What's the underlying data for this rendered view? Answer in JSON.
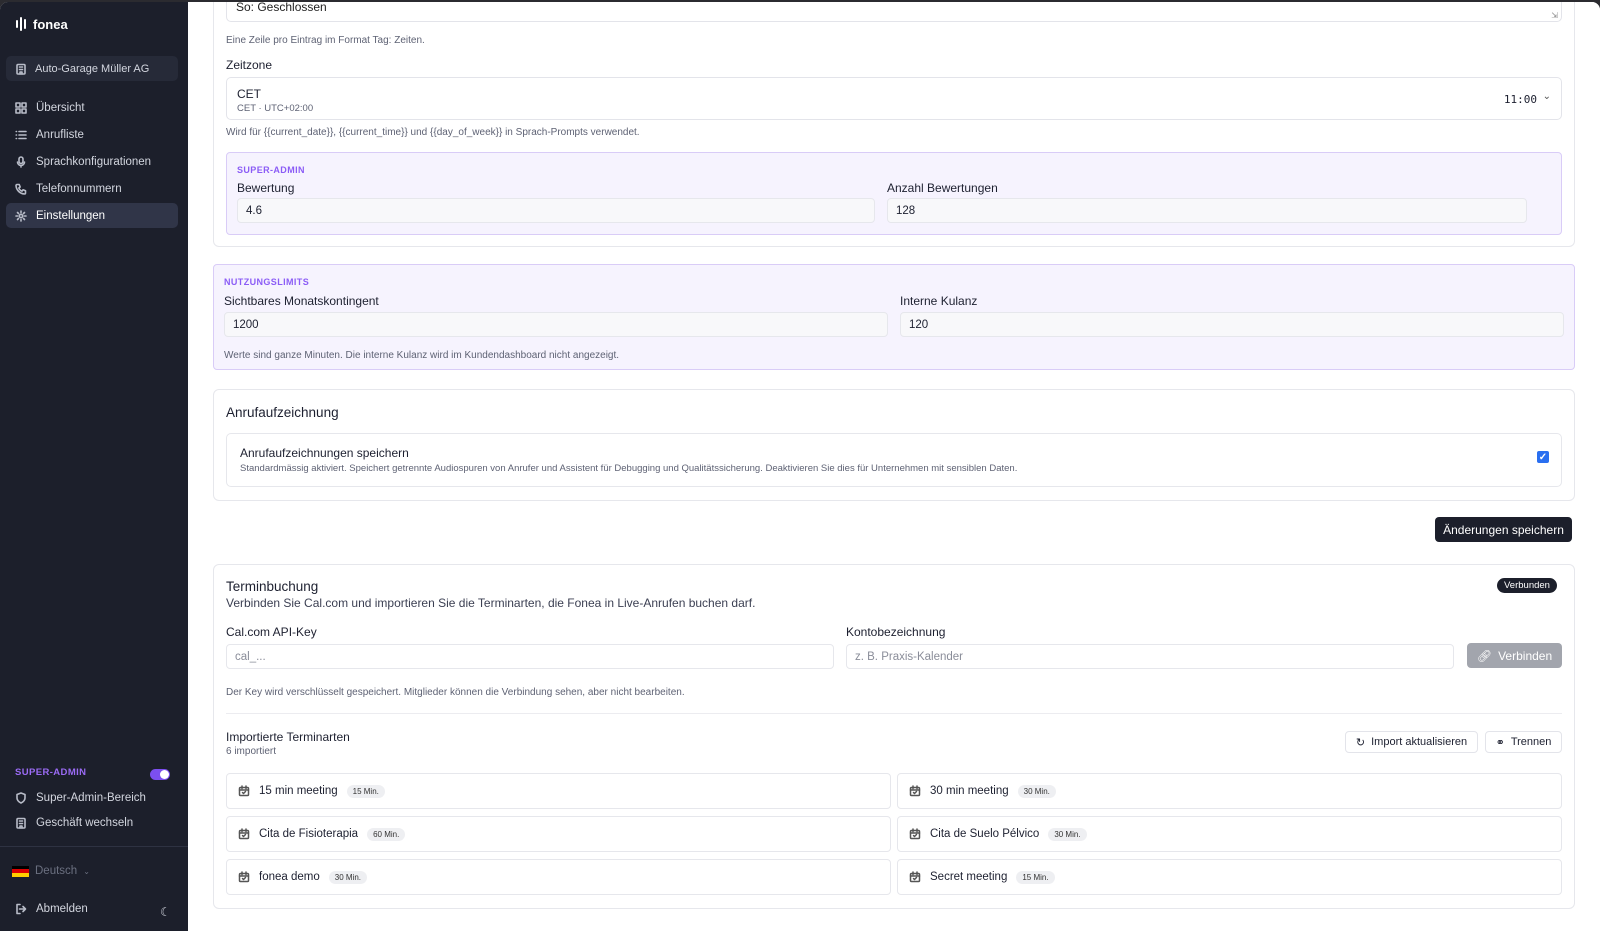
{
  "app": {
    "name": "fonea"
  },
  "sidebar": {
    "business": "Auto-Garage Müller AG",
    "items": [
      {
        "label": "Übersicht",
        "icon": "dashboard-icon"
      },
      {
        "label": "Anrufliste",
        "icon": "list-icon"
      },
      {
        "label": "Sprachkonfigurationen",
        "icon": "microphone-icon"
      },
      {
        "label": "Telefonnummern",
        "icon": "phone-icon"
      },
      {
        "label": "Einstellungen",
        "icon": "gear-icon",
        "active": true
      }
    ],
    "super_admin": {
      "label": "SUPER-ADMIN",
      "toggle_on": true,
      "items": [
        {
          "label": "Super-Admin-Bereich",
          "icon": "shield-icon"
        },
        {
          "label": "Geschäft wechseln",
          "icon": "building-icon"
        }
      ]
    },
    "language": "Deutsch",
    "logout": "Abmelden"
  },
  "hours": {
    "last_line": "So: Geschlossen",
    "help": "Eine Zeile pro Eintrag im Format Tag: Zeiten."
  },
  "timezone": {
    "label": "Zeitzone",
    "name": "CET",
    "offset": "CET · UTC+02:00",
    "time": "11:00",
    "help": "Wird für {{current_date}}, {{current_time}} und {{day_of_week}} in Sprach-Prompts verwendet."
  },
  "rating": {
    "section_label": "SUPER-ADMIN",
    "rating_label": "Bewertung",
    "rating_value": "4.6",
    "count_label": "Anzahl Bewertungen",
    "count_value": "128"
  },
  "limits": {
    "section_label": "NUTZUNGSLIMITS",
    "quota_label": "Sichtbares Monatskontingent",
    "quota_value": "1200",
    "grace_label": "Interne Kulanz",
    "grace_value": "120",
    "help": "Werte sind ganze Minuten. Die interne Kulanz wird im Kundendashboard nicht angezeigt."
  },
  "recording": {
    "title": "Anrufaufzeichnung",
    "option_title": "Anrufaufzeichnungen speichern",
    "option_desc": "Standardmässig aktiviert. Speichert getrennte Audiospuren von Anrufer und Assistent für Debugging und Qualitätssicherung. Deaktivieren Sie dies für Unternehmen mit sensiblen Daten.",
    "checked": true
  },
  "save_button": "Änderungen speichern",
  "booking": {
    "title": "Terminbuchung",
    "status": "Verbunden",
    "subtitle": "Verbinden Sie Cal.com und importieren Sie die Terminarten, die Fonea in Live-Anrufen buchen darf.",
    "api_key_label": "Cal.com API-Key",
    "api_key_placeholder": "cal_...",
    "account_label": "Kontobezeichnung",
    "account_placeholder": "z. B. Praxis-Kalender",
    "connect_button": "Verbinden",
    "help": "Der Key wird verschlüsselt gespeichert. Mitglieder können die Verbindung sehen, aber nicht bearbeiten.",
    "imported_title": "Importierte Terminarten",
    "imported_count": "6 importiert",
    "refresh_button": "Import aktualisieren",
    "disconnect_button": "Trennen",
    "event_types": [
      {
        "name": "15 min meeting",
        "duration": "15 Min."
      },
      {
        "name": "30 min meeting",
        "duration": "30 Min."
      },
      {
        "name": "Cita de Fisioterapia",
        "duration": "60 Min."
      },
      {
        "name": "Cita de Suelo Pélvico",
        "duration": "30 Min."
      },
      {
        "name": "fonea demo",
        "duration": "30 Min."
      },
      {
        "name": "Secret meeting",
        "duration": "15 Min."
      }
    ]
  }
}
